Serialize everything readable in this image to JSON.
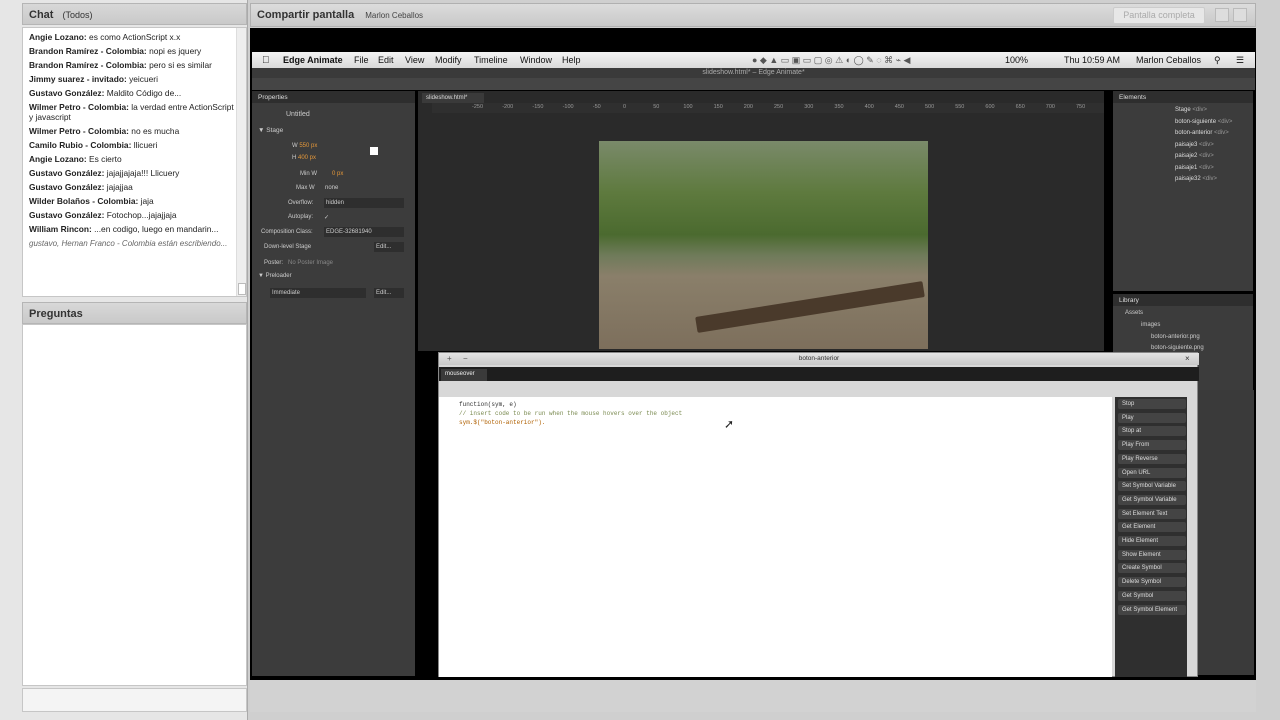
{
  "chat": {
    "title": "Chat",
    "filter": "(Todos)",
    "messages": [
      {
        "author": "Angie Lozano:",
        "text": "es como ActionScript x.x"
      },
      {
        "author": "Brandon Ramírez - Colombia:",
        "text": "nopi es jquery"
      },
      {
        "author": "Brandon Ramírez - Colombia:",
        "text": "pero si es similar"
      },
      {
        "author": "Jimmy suarez - invitado:",
        "text": "yeicueri"
      },
      {
        "author": "Gustavo González:",
        "text": "Maldito Código de..."
      },
      {
        "author": "Wilmer Petro - Colombia:",
        "text": "la verdad entre ActionScript y javascript"
      },
      {
        "author": "Wilmer Petro - Colombia:",
        "text": "no es mucha"
      },
      {
        "author": "Camilo Rubio - Colombia:",
        "text": "llicueri"
      },
      {
        "author": "Angie Lozano:",
        "text": "Es cierto"
      },
      {
        "author": "Gustavo González:",
        "text": "jajajjajaja!!! Llicuery"
      },
      {
        "author": "Gustavo González:",
        "text": "jajajjaa"
      },
      {
        "author": "Wilder Bolaños - Colombia:",
        "text": "jaja"
      },
      {
        "author": "Gustavo González:",
        "text": "Fotochop...jajajjaja"
      },
      {
        "author": "William Rincon:",
        "text": "...en codigo, luego en mandarin..."
      }
    ],
    "typing": "gustavo, Hernan Franco - Colombia están escribiendo..."
  },
  "questions": {
    "title": "Preguntas"
  },
  "share": {
    "title": "Compartir pantalla",
    "presenter": "Marlon Ceballos",
    "fullscreen": "Pantalla completa"
  },
  "mac": {
    "app": "Edge Animate",
    "menu": [
      "File",
      "Edit",
      "View",
      "Modify",
      "Timeline",
      "Window",
      "Help"
    ],
    "battery": "100%",
    "clock": "Thu 10:59 AM",
    "user": "Marlon Ceballos"
  },
  "edge": {
    "window_title": "slideshow.html* – Edge Animate*",
    "properties": {
      "tab": "Properties",
      "name": "Untitled",
      "stage": "Stage",
      "w": "550 px",
      "h": "400 px",
      "minw_label": "Min W",
      "minw": "0 px",
      "maxw_label": "Max W",
      "maxw": "none",
      "overflow_label": "Overflow:",
      "overflow": "hidden",
      "autoplay_label": "Autoplay:",
      "autoplay": "✓",
      "comp_label": "Composition Class:",
      "comp": "EDGE-32681940",
      "downlevel": "Down-level Stage",
      "edit": "Edit...",
      "poster_label": "Poster:",
      "poster": "No Poster Image",
      "preloader": "Preloader",
      "immediate": "Immediate"
    },
    "stage_tab": "slideshow.html*",
    "ruler": [
      "-250",
      "-200",
      "-150",
      "-100",
      "-50",
      "0",
      "50",
      "100",
      "150",
      "200",
      "250",
      "300",
      "350",
      "400",
      "450",
      "500",
      "550",
      "600",
      "650",
      "700",
      "750"
    ],
    "elements": {
      "tab": "Elements",
      "items": [
        {
          "name": "Stage",
          "tag": "<div>"
        },
        {
          "name": "boton-siguiente",
          "tag": "<div>"
        },
        {
          "name": "boton-anterior",
          "tag": "<div>"
        },
        {
          "name": "paisaje3",
          "tag": "<div>"
        },
        {
          "name": "paisaje2",
          "tag": "<div>"
        },
        {
          "name": "paisaje1",
          "tag": "<div>"
        },
        {
          "name": "paisaje32",
          "tag": "<div>"
        }
      ]
    },
    "library": {
      "tab": "Library",
      "assets": "Assets",
      "images": "images",
      "files": [
        "boton-anterior.png",
        "boton-siguiente.png"
      ]
    },
    "code": {
      "title": "boton-anterior",
      "tab": "mouseover",
      "lines": [
        "function(sym, e)",
        "// insert code to be run when the mouse hovers over the object",
        "sym.$(\"boton-anterior\")."
      ],
      "snippets": [
        "Stop",
        "Play",
        "Stop at",
        "Play From",
        "Play Reverse",
        "Open URL",
        "Set Symbol Variable",
        "Get Symbol Variable",
        "Set Element Text",
        "Get Element",
        "Hide Element",
        "Show Element",
        "Create Symbol",
        "Delete Symbol",
        "Get Symbol",
        "Get Symbol Element"
      ]
    }
  }
}
